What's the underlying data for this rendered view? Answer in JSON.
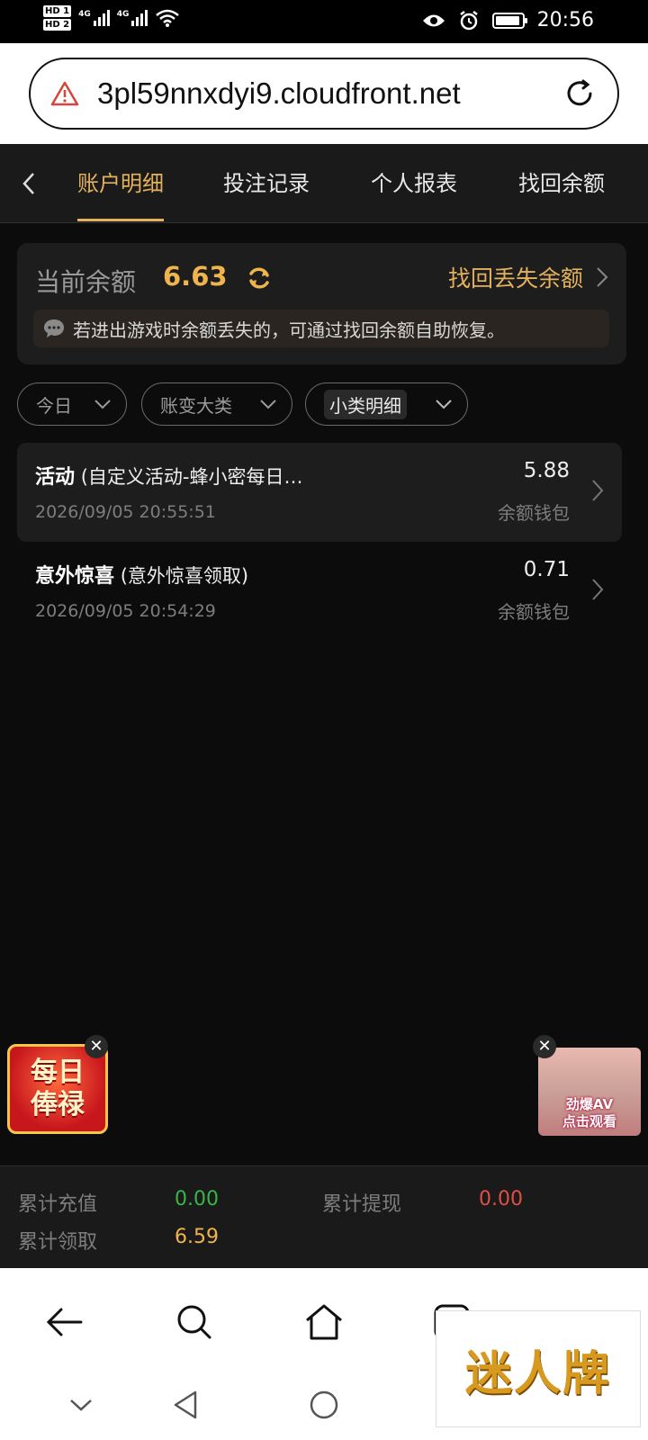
{
  "status_bar": {
    "sim1": "HD 1",
    "sim2": "HD 2",
    "net1": "4G",
    "net2": "4G",
    "time": "20:56"
  },
  "browser": {
    "url": "3pl59nnxdyi9.cloudfront.net"
  },
  "tabs": [
    {
      "label": "账户明细",
      "active": true
    },
    {
      "label": "投注记录",
      "active": false
    },
    {
      "label": "个人报表",
      "active": false
    },
    {
      "label": "找回余额",
      "active": false
    }
  ],
  "balance": {
    "label": "当前余额",
    "value": "6.63",
    "recover_label": "找回丢失余额",
    "notice": "若进出游戏时余额丢失的，可通过找回余额自助恢复。"
  },
  "filters": [
    {
      "label": "今日",
      "selected": false
    },
    {
      "label": "账变大类",
      "selected": false
    },
    {
      "label": "小类明细",
      "selected": true
    }
  ],
  "records": [
    {
      "title": "活动",
      "detail": "(自定义活动-蜂小密每日…",
      "time": "2026/09/05 20:55:51",
      "amount": "5.88",
      "wallet": "余额钱包"
    },
    {
      "title": "意外惊喜",
      "detail": "(意外惊喜领取)",
      "time": "2026/09/05 20:54:29",
      "amount": "0.71",
      "wallet": "余额钱包"
    }
  ],
  "ads": {
    "left_line1": "每日",
    "left_line2": "俸禄",
    "right_line1": "劲爆AV",
    "right_line2": "点击观看"
  },
  "summary": {
    "recharge_label": "累计充值",
    "recharge_value": "0.00",
    "withdraw_label": "累计提现",
    "withdraw_value": "0.00",
    "claimed_label": "累计领取",
    "claimed_value": "6.59"
  },
  "watermark": "迷人牌",
  "colors": {
    "accent": "#e3b15d",
    "balance": "#f0b44c",
    "positive": "#38b546",
    "negative": "#e04e45",
    "claimed": "#f0b44c"
  }
}
